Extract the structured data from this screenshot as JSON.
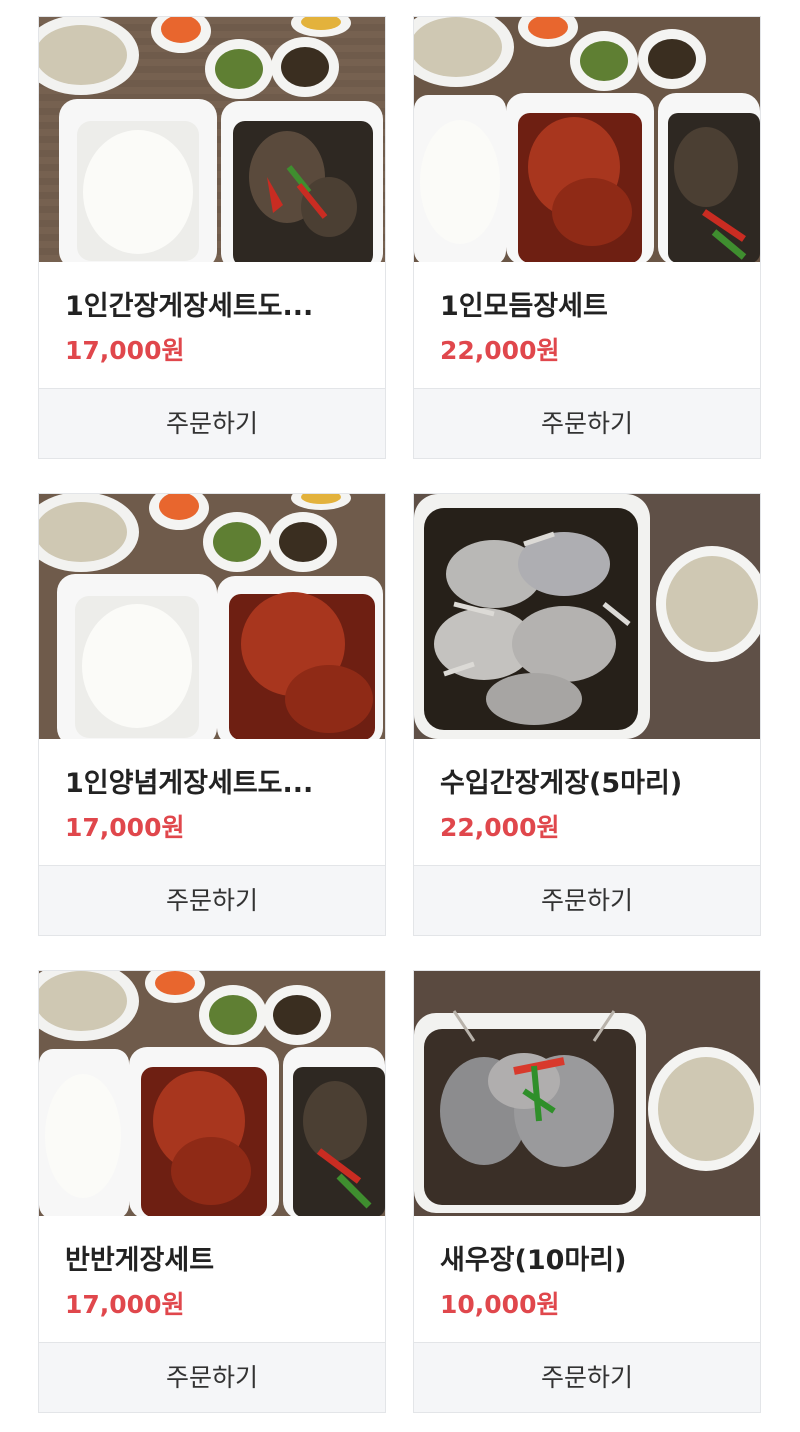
{
  "products": [
    {
      "name": "1인간장게장세트도...",
      "price": "17,000원",
      "order_label": "주문하기",
      "image": "soy-crab-set-photo"
    },
    {
      "name": "1인모듬장세트",
      "price": "22,000원",
      "order_label": "주문하기",
      "image": "assorted-set-photo"
    },
    {
      "name": "1인양념게장세트도...",
      "price": "17,000원",
      "order_label": "주문하기",
      "image": "spicy-crab-set-photo"
    },
    {
      "name": "수입간장게장(5마리)",
      "price": "22,000원",
      "order_label": "주문하기",
      "image": "soy-crab-5pc-photo"
    },
    {
      "name": "반반게장세트",
      "price": "17,000원",
      "order_label": "주문하기",
      "image": "half-half-crab-set-photo"
    },
    {
      "name": "새우장(10마리)",
      "price": "10,000원",
      "order_label": "주문하기",
      "image": "soy-shrimp-10pc-photo"
    }
  ],
  "colors": {
    "price": "#e0474c",
    "button_bg": "#f5f6f8",
    "border": "#e3e5e8"
  }
}
